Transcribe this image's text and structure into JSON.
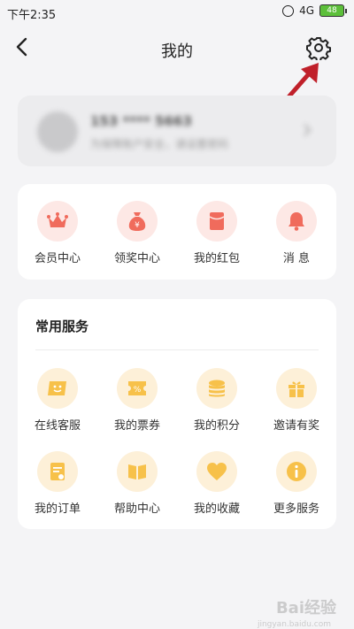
{
  "status_bar": {
    "time": "下午2:35",
    "network": "4G",
    "battery": "48"
  },
  "header": {
    "title": "我的"
  },
  "profile": {
    "phone": "153 **** 5663",
    "tip": "为保障账户安全，请设置密码"
  },
  "quick_actions": [
    {
      "label": "会员中心",
      "icon": "crown-icon"
    },
    {
      "label": "领奖中心",
      "icon": "money-bag-icon"
    },
    {
      "label": "我的红包",
      "icon": "red-envelope-icon"
    },
    {
      "label": "消 息",
      "icon": "bell-icon"
    }
  ],
  "services": {
    "title": "常用服务",
    "items": [
      {
        "label": "在线客服",
        "icon": "chat-icon"
      },
      {
        "label": "我的票券",
        "icon": "ticket-icon"
      },
      {
        "label": "我的积分",
        "icon": "coins-icon"
      },
      {
        "label": "邀请有奖",
        "icon": "gift-icon"
      },
      {
        "label": "我的订单",
        "icon": "order-icon"
      },
      {
        "label": "帮助中心",
        "icon": "book-icon"
      },
      {
        "label": "我的收藏",
        "icon": "heart-icon"
      },
      {
        "label": "更多服务",
        "icon": "info-icon"
      }
    ]
  },
  "watermark": {
    "text": "Bai经验",
    "sub": "jingyan.baidu.com"
  },
  "colors": {
    "quick_accent": "#f06b5c",
    "quick_bg": "#fde8e5",
    "service_accent": "#f7c14a",
    "service_bg": "#fdf0d8",
    "arrow": "#c0202a"
  }
}
